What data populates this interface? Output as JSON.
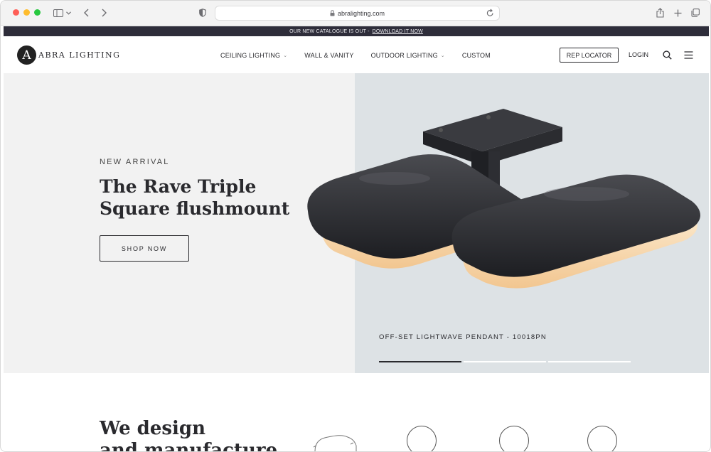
{
  "browser": {
    "url": "abralighting.com"
  },
  "announcement": {
    "text": "OUR NEW CATALOGUE IS OUT -",
    "link": "DOWNLOAD IT NOW"
  },
  "header": {
    "logo_letter": "A",
    "logo_text": "ABRA LIGHTING",
    "nav": [
      {
        "label": "CEILING LIGHTING",
        "has_dropdown": true
      },
      {
        "label": "WALL & VANITY",
        "has_dropdown": false
      },
      {
        "label": "OUTDOOR LIGHTING",
        "has_dropdown": true
      },
      {
        "label": "CUSTOM",
        "has_dropdown": false
      }
    ],
    "rep_locator": "REP LOCATOR",
    "login": "LOGIN",
    "icons": [
      "search-icon",
      "hamburger-menu-icon"
    ]
  },
  "hero": {
    "eyebrow": "NEW ARRIVAL",
    "title_line1": "The Rave Triple",
    "title_line2": "Square flushmount",
    "cta": "SHOP NOW",
    "caption": "OFF-SET LIGHTWAVE PENDANT - 10018PN",
    "slides": {
      "count": 3,
      "active": 1
    }
  },
  "section": {
    "title_line1": "We design",
    "title_line2": "and manufacture"
  },
  "colors": {
    "announce_bg": "#2e2d3a",
    "hero_left_bg": "#f2f2f2",
    "hero_right_bg": "#dde2e5",
    "text": "#2a2a2e"
  }
}
